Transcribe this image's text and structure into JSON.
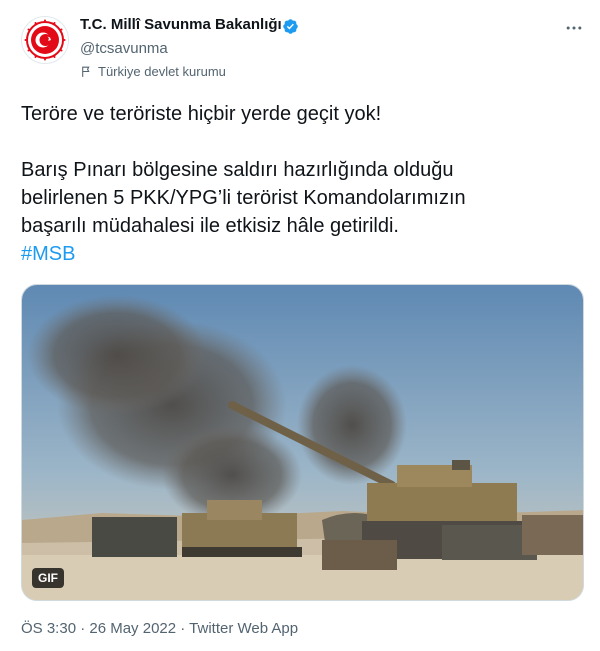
{
  "tweet": {
    "author_name": "T.C. Millî Savunma Bakanlığı",
    "handle": "@tcsavunma",
    "account_label": "Türkiye devlet kurumu",
    "text_line1": "Teröre ve teröriste hiçbir yerde geçit yok!",
    "text_line2": "Barış Pınarı bölgesine saldırı hazırlığında olduğu",
    "text_line3": "belirlenen 5 PKK/YPG’li terörist Komandolarımızın",
    "text_line4": "başarılı müdahalesi ile etkisiz hâle getirildi.",
    "hashtag": "#MSB",
    "media_badge": "GIF",
    "timestamp": "ÖS 3:30 · 26 May 2022 · Twitter Web App"
  },
  "icons": {
    "verified": "verified-badge-icon",
    "label": "flag-icon",
    "more": "more-options-icon"
  },
  "colors": {
    "link": "#1d9bf0",
    "secondary_text": "#536471",
    "avatar_red": "#e30a17"
  }
}
